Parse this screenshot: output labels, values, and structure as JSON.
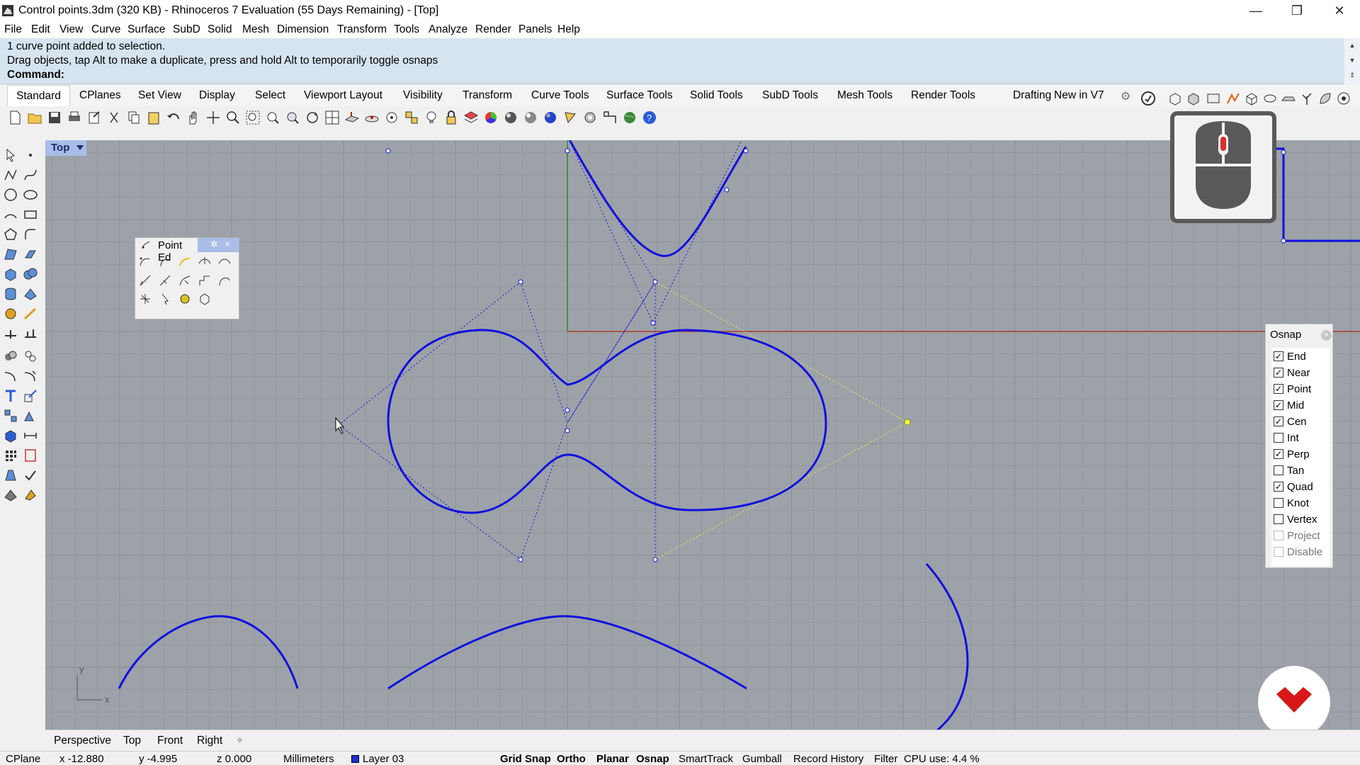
{
  "window": {
    "title": "Control points.3dm (320 KB) - Rhinoceros 7 Evaluation (55 Days Remaining) - [Top]",
    "minimize_glyph": "—",
    "maximize_glyph": "❐",
    "close_glyph": "✕"
  },
  "menu": [
    "File",
    "Edit",
    "View",
    "Curve",
    "Surface",
    "SubD",
    "Solid",
    "Mesh",
    "Dimension",
    "Transform",
    "Tools",
    "Analyze",
    "Render",
    "Panels",
    "Help"
  ],
  "command": {
    "history": [
      "1 curve point added to selection.",
      "Drag objects, tap Alt to make a duplicate, press and hold Alt to temporarily toggle osnaps"
    ],
    "prompt": "Command:"
  },
  "toolbar_tabs": {
    "active": "Standard",
    "tabs": [
      "Standard",
      "CPlanes",
      "Set View",
      "Display",
      "Select",
      "Viewport Layout",
      "Visibility",
      "Transform",
      "Curve Tools",
      "Surface Tools",
      "Solid Tools",
      "SubD Tools",
      "Mesh Tools",
      "Render Tools",
      "Drafting",
      "New in V7"
    ]
  },
  "viewport": {
    "name": "Top",
    "axis_x_label": "x",
    "axis_y_label": "y"
  },
  "point_edit_panel": {
    "title": "Point Ed",
    "gear_glyph": "✲",
    "close_glyph": "×"
  },
  "osnap": {
    "title": "Osnap",
    "close_glyph": "×",
    "items": [
      {
        "label": "End",
        "checked": true,
        "enabled": true
      },
      {
        "label": "Near",
        "checked": true,
        "enabled": true
      },
      {
        "label": "Point",
        "checked": true,
        "enabled": true
      },
      {
        "label": "Mid",
        "checked": true,
        "enabled": true
      },
      {
        "label": "Cen",
        "checked": true,
        "enabled": true
      },
      {
        "label": "Int",
        "checked": false,
        "enabled": true
      },
      {
        "label": "Perp",
        "checked": true,
        "enabled": true
      },
      {
        "label": "Tan",
        "checked": false,
        "enabled": true
      },
      {
        "label": "Quad",
        "checked": true,
        "enabled": true
      },
      {
        "label": "Knot",
        "checked": false,
        "enabled": true
      },
      {
        "label": "Vertex",
        "checked": false,
        "enabled": true
      },
      {
        "label": "Project",
        "checked": false,
        "enabled": false
      },
      {
        "label": "Disable",
        "checked": false,
        "enabled": false
      }
    ]
  },
  "view_tabs": [
    "Perspective",
    "Top",
    "Front",
    "Right"
  ],
  "view_tabs_add": "⌖",
  "status": {
    "cplane": "CPlane",
    "x": "x -12.880",
    "y": "y -4.995",
    "z": "z 0.000",
    "units": "Millimeters",
    "layer": "Layer 03",
    "layer_color": "#1f2bd8",
    "grid_snap": "Grid Snap",
    "ortho": "Ortho",
    "planar": "Planar",
    "osnap": "Osnap",
    "smarttrack": "SmartTrack",
    "gumball": "Gumball",
    "record_history": "Record History",
    "filter": "Filter",
    "cpu": "CPU use: 4.4 %"
  },
  "colors": {
    "curve": "#1010e0",
    "grid": "#8e9399",
    "viewport_bg": "#9da2a8",
    "x_axis": "#b03a2e",
    "y_axis": "#2e8a36",
    "selected_polygon": "#e6e65a",
    "viewport_title_bg": "#a8bde8"
  }
}
